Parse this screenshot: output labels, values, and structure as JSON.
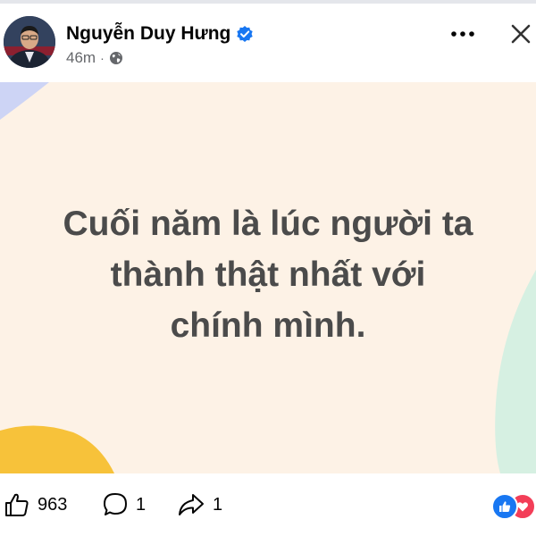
{
  "post": {
    "author_name": "Nguyễn Duy Hưng",
    "timestamp": "46m",
    "separator": "·",
    "verified": true,
    "privacy_icon": "globe-icon",
    "text_lines": [
      "Cuối năm là lúc người ta",
      "thành thật nhất với",
      "chính mình."
    ],
    "background_color": "#fdf2e6",
    "text_color": "#4b4b4b"
  },
  "actions": {
    "like_count": "963",
    "comment_count": "1",
    "share_count": "1"
  },
  "icons": {
    "more": "more-horizontal-icon",
    "close": "close-icon",
    "like": "thumbs-up-icon",
    "comment": "comment-bubble-icon",
    "share": "share-arrow-icon",
    "verified": "verified-badge-icon"
  },
  "colors": {
    "accent": "#1877f2",
    "love": "#f33e58",
    "muted_text": "#65676b"
  }
}
